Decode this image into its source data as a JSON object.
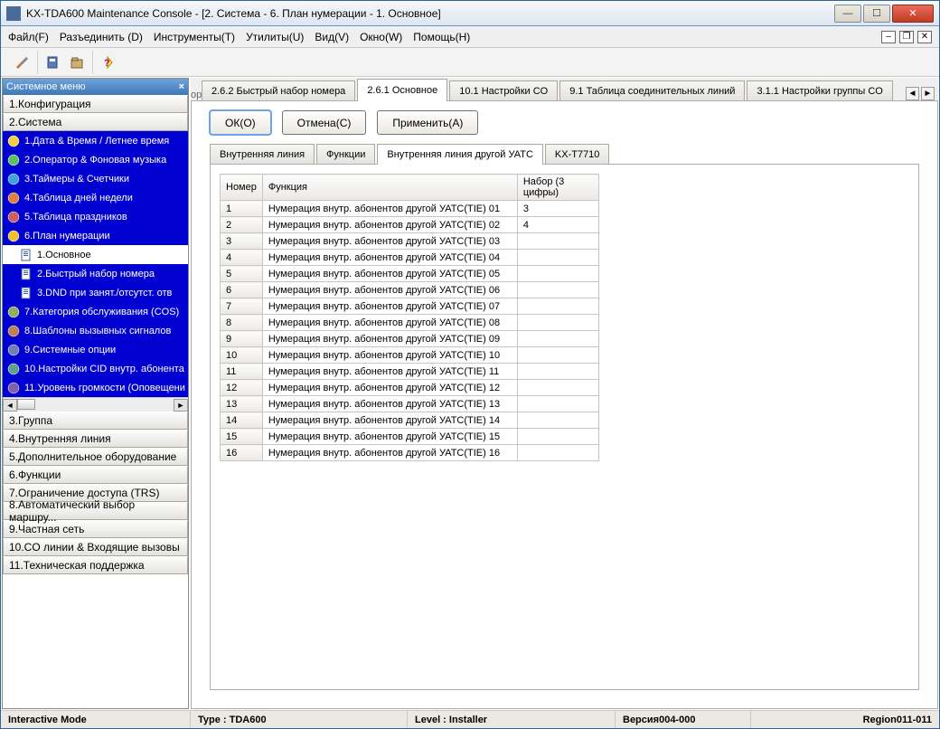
{
  "window": {
    "title": "KX-TDA600 Maintenance Console - [2. Система - 6. План нумерации - 1. Основное]"
  },
  "menu": {
    "file": "Файл(F)",
    "disconnect": "Разъединить (D)",
    "tools": "Инструменты(T)",
    "utilities": "Утилиты(U)",
    "view": "Вид(V)",
    "window": "Окно(W)",
    "help": "Помощь(H)"
  },
  "sidebar": {
    "header": "Системное меню",
    "sections_top": [
      "1.Конфигурация",
      "2.Система"
    ],
    "tree": [
      {
        "label": "1.Дата & Время / Летнее время"
      },
      {
        "label": "2.Оператор & Фоновая музыка"
      },
      {
        "label": "3.Таймеры & Счетчики"
      },
      {
        "label": "4.Таблица дней недели"
      },
      {
        "label": "5.Таблица праздников"
      },
      {
        "label": "6.План нумерации",
        "children": [
          {
            "label": "1.Основное",
            "selected": true
          },
          {
            "label": "2.Быстрый набор номера"
          },
          {
            "label": "3.DND при занят./отсутст. отв"
          }
        ]
      },
      {
        "label": "7.Категория обслуживания (COS)"
      },
      {
        "label": "8.Шаблоны вызывных сигналов"
      },
      {
        "label": "9.Системные опции"
      },
      {
        "label": "10.Настройки CID внутр. абонента"
      },
      {
        "label": "11.Уровень громкости (Оповещени"
      }
    ],
    "sections_bottom": [
      "3.Группа",
      "4.Внутренняя линия",
      "5.Дополнительное оборудование",
      "6.Функции",
      "7.Ограничение доступа (TRS)",
      "8.Автоматический выбор маршру...",
      "9.Частная сеть",
      "10.CO линии & Входящие вызовы",
      "11.Техническая поддержка"
    ]
  },
  "tabs": {
    "leading_hint": "ор",
    "main": [
      {
        "label": "2.6.2 Быстрый набор номера"
      },
      {
        "label": "2.6.1 Основное",
        "active": true
      },
      {
        "label": "10.1 Настройки CO"
      },
      {
        "label": "9.1 Таблица соединительных линий"
      },
      {
        "label": "3.1.1 Настройки группы CO"
      }
    ],
    "sub": [
      {
        "label": "Внутренняя линия"
      },
      {
        "label": "Функции"
      },
      {
        "label": "Внутренняя линия другой УАТС",
        "active": true
      },
      {
        "label": "KX-T7710"
      }
    ]
  },
  "buttons": {
    "ok": "ОК(O)",
    "cancel": "Отмена(C)",
    "apply": "Применить(A)"
  },
  "table": {
    "headers": {
      "no": "Номер",
      "func": "Функция",
      "dial": "Набор (3 цифры)"
    },
    "rows": [
      {
        "no": "1",
        "func": "Нумерация внутр. абонентов другой УАТС(TIE) 01",
        "dial": "3"
      },
      {
        "no": "2",
        "func": "Нумерация внутр. абонентов другой УАТС(TIE) 02",
        "dial": "4"
      },
      {
        "no": "3",
        "func": "Нумерация внутр. абонентов другой УАТС(TIE) 03",
        "dial": ""
      },
      {
        "no": "4",
        "func": "Нумерация внутр. абонентов другой УАТС(TIE) 04",
        "dial": ""
      },
      {
        "no": "5",
        "func": "Нумерация внутр. абонентов другой УАТС(TIE) 05",
        "dial": ""
      },
      {
        "no": "6",
        "func": "Нумерация внутр. абонентов другой УАТС(TIE) 06",
        "dial": ""
      },
      {
        "no": "7",
        "func": "Нумерация внутр. абонентов другой УАТС(TIE) 07",
        "dial": ""
      },
      {
        "no": "8",
        "func": "Нумерация внутр. абонентов другой УАТС(TIE) 08",
        "dial": ""
      },
      {
        "no": "9",
        "func": "Нумерация внутр. абонентов другой УАТС(TIE) 09",
        "dial": ""
      },
      {
        "no": "10",
        "func": "Нумерация внутр. абонентов другой УАТС(TIE) 10",
        "dial": ""
      },
      {
        "no": "11",
        "func": "Нумерация внутр. абонентов другой УАТС(TIE) 11",
        "dial": ""
      },
      {
        "no": "12",
        "func": "Нумерация внутр. абонентов другой УАТС(TIE) 12",
        "dial": ""
      },
      {
        "no": "13",
        "func": "Нумерация внутр. абонентов другой УАТС(TIE) 13",
        "dial": ""
      },
      {
        "no": "14",
        "func": "Нумерация внутр. абонентов другой УАТС(TIE) 14",
        "dial": ""
      },
      {
        "no": "15",
        "func": "Нумерация внутр. абонентов другой УАТС(TIE) 15",
        "dial": ""
      },
      {
        "no": "16",
        "func": "Нумерация внутр. абонентов другой УАТС(TIE) 16",
        "dial": ""
      }
    ]
  },
  "status": {
    "mode": "Interactive Mode",
    "type": "Type : TDA600",
    "level": "Level : Installer",
    "version": "Версия004-000",
    "region": "Region011-011"
  }
}
